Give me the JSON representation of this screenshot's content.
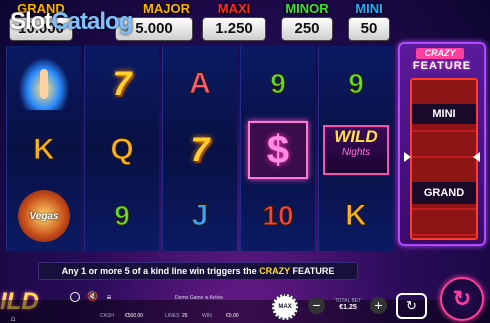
{
  "watermark": {
    "prefix": "Slot",
    "suffix": "Catalog"
  },
  "jackpots": {
    "grand": {
      "label": "GRAND",
      "value": "10.000",
      "label_color": "#ffb400"
    },
    "major": {
      "label": "MAJOR",
      "value": "5.000",
      "label_color": "#ffb400"
    },
    "maxi": {
      "label": "MAXI",
      "value": "1.250",
      "label_color": "#ff2a2a"
    },
    "minor": {
      "label": "MINOR",
      "value": "250",
      "label_color": "#40e03a"
    },
    "mini": {
      "label": "MINI",
      "value": "50",
      "label_color": "#2aa8ff"
    }
  },
  "reels": [
    [
      "showgirl",
      "K",
      "vegas"
    ],
    [
      "7",
      "Q",
      "9"
    ],
    [
      "A",
      "7",
      "J"
    ],
    [
      "9",
      "$",
      "10"
    ],
    [
      "9",
      "WILD",
      "K"
    ]
  ],
  "symbols": {
    "wild_line1": "WILD",
    "wild_line2": "Nights",
    "vegas_label": "Vegas",
    "dollar": "$",
    "seven": "7"
  },
  "feature_panel": {
    "crazy": "CRAZY",
    "title": "FEATURE",
    "items": [
      "MINI",
      "GRAND"
    ]
  },
  "banner": {
    "text_before": "Any 1 or more 5 of a kind line win triggers the ",
    "crazy": "CRAZY",
    "text_after": " FEATURE"
  },
  "logo_text": "ILD",
  "status": {
    "game_status": "Demo Game is Active"
  },
  "bottom": {
    "cash_label": "CASH",
    "cash_value": "€500.00",
    "lines_label": "LINES",
    "lines_value": "25",
    "win_label": "WIN",
    "win_value": "€0.00",
    "total_bet_label": "TOTAL BET",
    "total_bet_value": "€1.25",
    "max_label": "MAX"
  },
  "icons": {
    "settings": "gear-icon",
    "info": "info-icon",
    "sound": "speaker-muted-icon",
    "paytable": "list-icon",
    "home": "home-icon"
  }
}
